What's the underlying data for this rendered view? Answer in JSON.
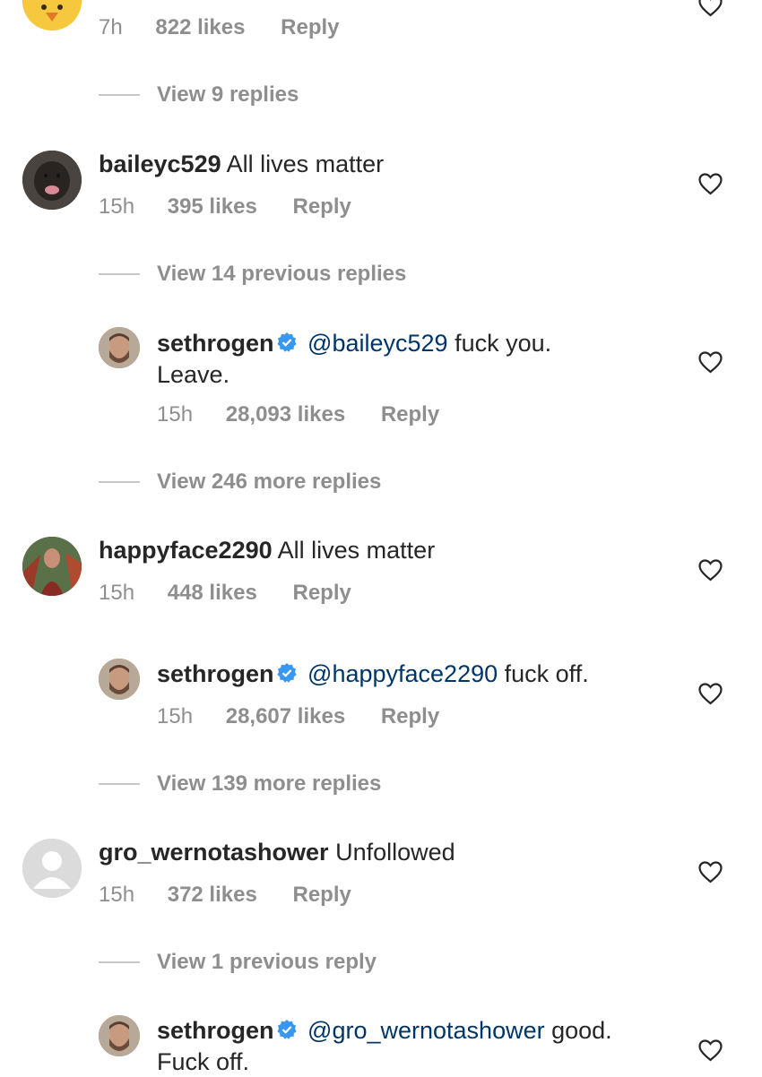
{
  "comments": [
    {
      "id": "c0",
      "time": "7h",
      "likes": "822 likes",
      "reply_label": "Reply",
      "view_replies": "View 9 replies"
    },
    {
      "id": "c1",
      "username": "baileyc529",
      "text": "All lives matter",
      "time": "15h",
      "likes": "395 likes",
      "reply_label": "Reply",
      "view_replies": "View 14 previous replies",
      "reply": {
        "username": "sethrogen",
        "verified": true,
        "mention": "@baileyc529",
        "text_line1": "fuck you.",
        "text_line2": "Leave.",
        "time": "15h",
        "likes": "28,093 likes",
        "reply_label": "Reply"
      },
      "view_more": "View 246 more replies"
    },
    {
      "id": "c2",
      "username": "happyface2290",
      "text": "All lives matter",
      "time": "15h",
      "likes": "448 likes",
      "reply_label": "Reply",
      "reply": {
        "username": "sethrogen",
        "verified": true,
        "mention": "@happyface2290",
        "text_line1": "fuck off.",
        "time": "15h",
        "likes": "28,607 likes",
        "reply_label": "Reply"
      },
      "view_more": "View 139 more replies"
    },
    {
      "id": "c3",
      "username": "gro_wernotashower",
      "text": "Unfollowed",
      "time": "15h",
      "likes": "372 likes",
      "reply_label": "Reply",
      "view_replies": "View 1 previous reply",
      "reply": {
        "username": "sethrogen",
        "verified": true,
        "mention": "@gro_wernotashower",
        "text_line1": "good.",
        "text_line2": "Fuck off."
      }
    }
  ],
  "icons": {
    "heart": "heart-outline-icon",
    "verified": "verified-badge-icon"
  },
  "colors": {
    "text": "#262626",
    "meta": "#8e8e8e",
    "mention": "#003569",
    "verified": "#3897f0"
  }
}
